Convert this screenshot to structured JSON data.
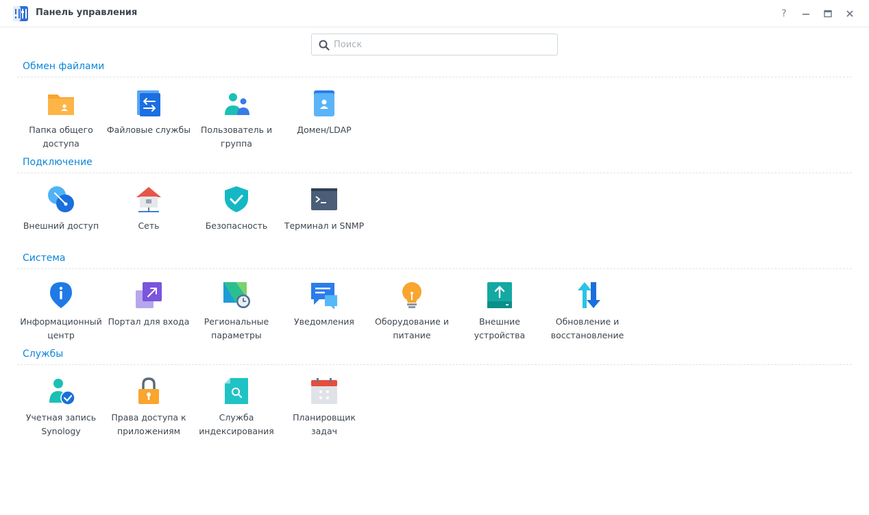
{
  "window": {
    "title": "Панель управления",
    "help": "?",
    "minimize": "–",
    "maximize": "□",
    "close": "✕"
  },
  "search": {
    "placeholder": "Поиск",
    "value": ""
  },
  "sections": [
    {
      "title": "Обмен файлами",
      "items": [
        {
          "label": "Папка общего доступа",
          "icon": "shared-folder-icon"
        },
        {
          "label": "Файловые службы",
          "icon": "file-services-icon"
        },
        {
          "label": "Пользователь и группа",
          "icon": "user-group-icon"
        },
        {
          "label": "Домен/LDAP",
          "icon": "domain-ldap-icon"
        }
      ]
    },
    {
      "title": "Подключение",
      "items": [
        {
          "label": "Внешний доступ",
          "icon": "external-access-icon"
        },
        {
          "label": "Сеть",
          "icon": "network-icon"
        },
        {
          "label": "Безопасность",
          "icon": "security-icon"
        },
        {
          "label": "Терминал и SNMP",
          "icon": "terminal-icon"
        }
      ]
    },
    {
      "title": "Система",
      "items": [
        {
          "label": "Информационный центр",
          "icon": "info-center-icon"
        },
        {
          "label": "Портал для входа",
          "icon": "login-portal-icon"
        },
        {
          "label": "Региональные параметры",
          "icon": "regional-options-icon"
        },
        {
          "label": "Уведомления",
          "icon": "notification-icon"
        },
        {
          "label": "Оборудование и питание",
          "icon": "hardware-power-icon"
        },
        {
          "label": "Внешние устройства",
          "icon": "external-devices-icon"
        },
        {
          "label": "Обновление и восстановление",
          "icon": "update-restore-icon"
        }
      ]
    },
    {
      "title": "Службы",
      "items": [
        {
          "label": "Учетная запись Synology",
          "icon": "synology-account-icon"
        },
        {
          "label": "Права доступа к приложениям",
          "icon": "app-privileges-icon"
        },
        {
          "label": "Служба индексирования",
          "icon": "indexing-service-icon"
        },
        {
          "label": "Планировщик задач",
          "icon": "task-scheduler-icon"
        }
      ]
    }
  ],
  "colors": {
    "accent": "#0a86d9",
    "text": "#3d4650",
    "divider": "#dfe3e7"
  }
}
